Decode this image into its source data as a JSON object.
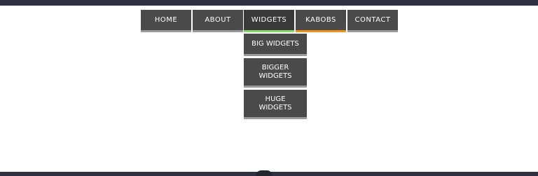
{
  "nav": {
    "items": [
      {
        "label": "HOME"
      },
      {
        "label": "ABOUT"
      },
      {
        "label": "WIDGETS"
      },
      {
        "label": "KABOBS"
      },
      {
        "label": "CONTACT"
      }
    ]
  },
  "dropdown": {
    "items": [
      {
        "label": "BIG WIDGETS"
      },
      {
        "label": "BIGGER WIDGETS"
      },
      {
        "label": "HUGE WIDGETS"
      }
    ]
  },
  "colors": {
    "nav_bg": "#4a4a4a",
    "widgets_underline": "#8bd86a",
    "kabobs_underline": "#f0921e",
    "frame_bar": "#2f3240"
  }
}
